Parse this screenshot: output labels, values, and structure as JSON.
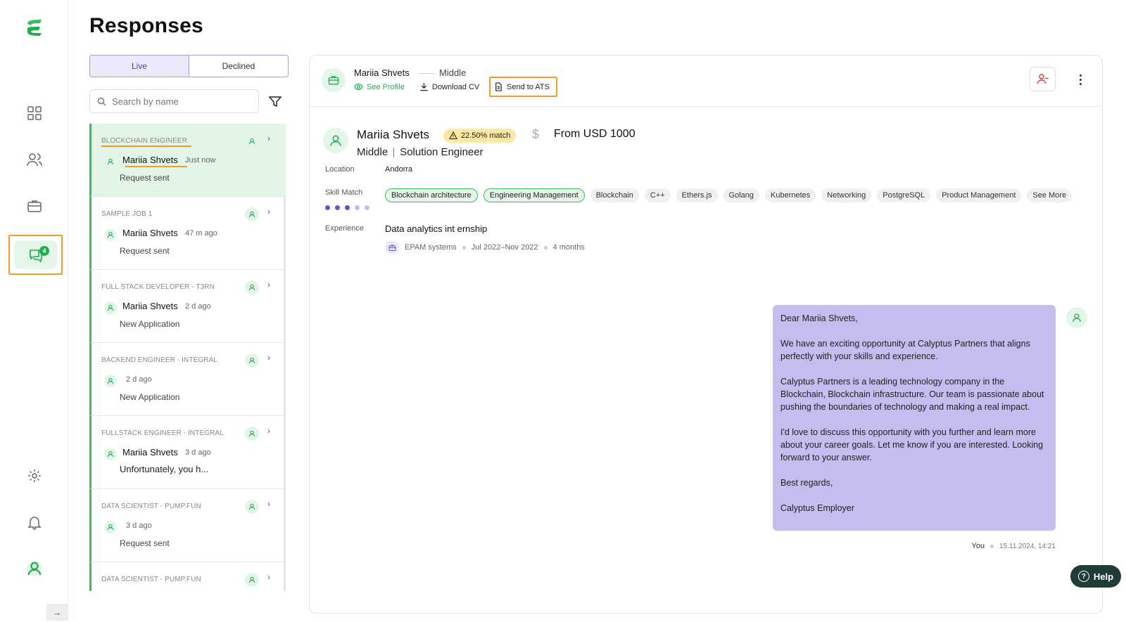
{
  "page": {
    "title": "Responses"
  },
  "rail": {
    "chat_badge": "4",
    "expand_icon": "→"
  },
  "tabs": [
    {
      "label": "Live"
    },
    {
      "label": "Declined"
    }
  ],
  "search": {
    "placeholder": "Search by name"
  },
  "list": [
    {
      "job": "BLOCKCHAIN ENGINEER",
      "name": "Mariia Shvets",
      "time": "Just now",
      "status": "Request sent"
    },
    {
      "job": "SAMPLE JOB 1",
      "name": "Mariia Shvets",
      "time": "47 m ago",
      "status": "Request sent"
    },
    {
      "job": "FULL STACK DEVELOPER - T3RN",
      "name": "Mariia Shvets",
      "time": "2 d ago",
      "status": "New Application"
    },
    {
      "job": "BACKEND ENGINEER - INTEGRAL",
      "name": "",
      "time": "2 d ago",
      "status": "New Application"
    },
    {
      "job": "FULLSTACK ENGINEER - INTEGRAL",
      "name": "Mariia Shvets",
      "time": "3 d ago",
      "status": "Unfortunately, you h..."
    },
    {
      "job": "DATA SCIENTIST - PUMP.FUN",
      "name": "",
      "time": "3 d ago",
      "status": "Request sent"
    },
    {
      "job": "DATA SCIENTIST - PUMP.FUN",
      "name": "",
      "time": "",
      "status": ""
    }
  ],
  "header": {
    "name": "Mariia Shvets",
    "level": "Middle",
    "see_profile": "See Profile",
    "download_cv": "Download CV",
    "send_ats": "Send to ATS"
  },
  "candidate": {
    "name": "Mariia Shvets",
    "match": "22.50% match",
    "currency_icon": "$",
    "salary": "From USD 1000",
    "level": "Middle",
    "role": "Solution Engineer",
    "location_label": "Location",
    "location": "Andorra",
    "skill_label": "Skill Match",
    "skills": [
      "Blockchain architecture",
      "Engineering Management",
      "Blockchain",
      "C++",
      "Ethers.js",
      "Golang",
      "Kubernetes",
      "Networking",
      "PostgreSQL",
      "Product Management",
      "See More"
    ],
    "skill_level": 3,
    "skill_level_max": 5,
    "experience_label": "Experience",
    "experience_title": "Data analytics int ernship",
    "experience_company": "EPAM systems",
    "experience_period": "Jul 2022–Nov 2022",
    "experience_duration": "4 months"
  },
  "message": {
    "p1": "Dear Mariia Shvets,",
    "p2": "We have an exciting opportunity at Calyptus Partners that aligns perfectly with your skills and experience.",
    "p3": "Calyptus Partners is a leading technology company in the Blockchain, Blockchain infrastructure. Our team is passionate about pushing the boundaries of technology and making a real impact.",
    "p4": "I'd love to discuss this opportunity with you further and learn more about your career goals. Let me know if you are interested. Looking forward to your answer.",
    "p5": "Best regards,",
    "p6": "Calyptus Employer",
    "sender": "You",
    "timestamp": "15.11.2024, 14:21"
  },
  "help": {
    "label": "Help",
    "icon": "?"
  },
  "colors": {
    "accent_green": "#1fae4a",
    "highlight_orange": "#f39a2b",
    "bubble_purple": "#c3bdf0",
    "tab_purple": "#4b3fa8"
  }
}
